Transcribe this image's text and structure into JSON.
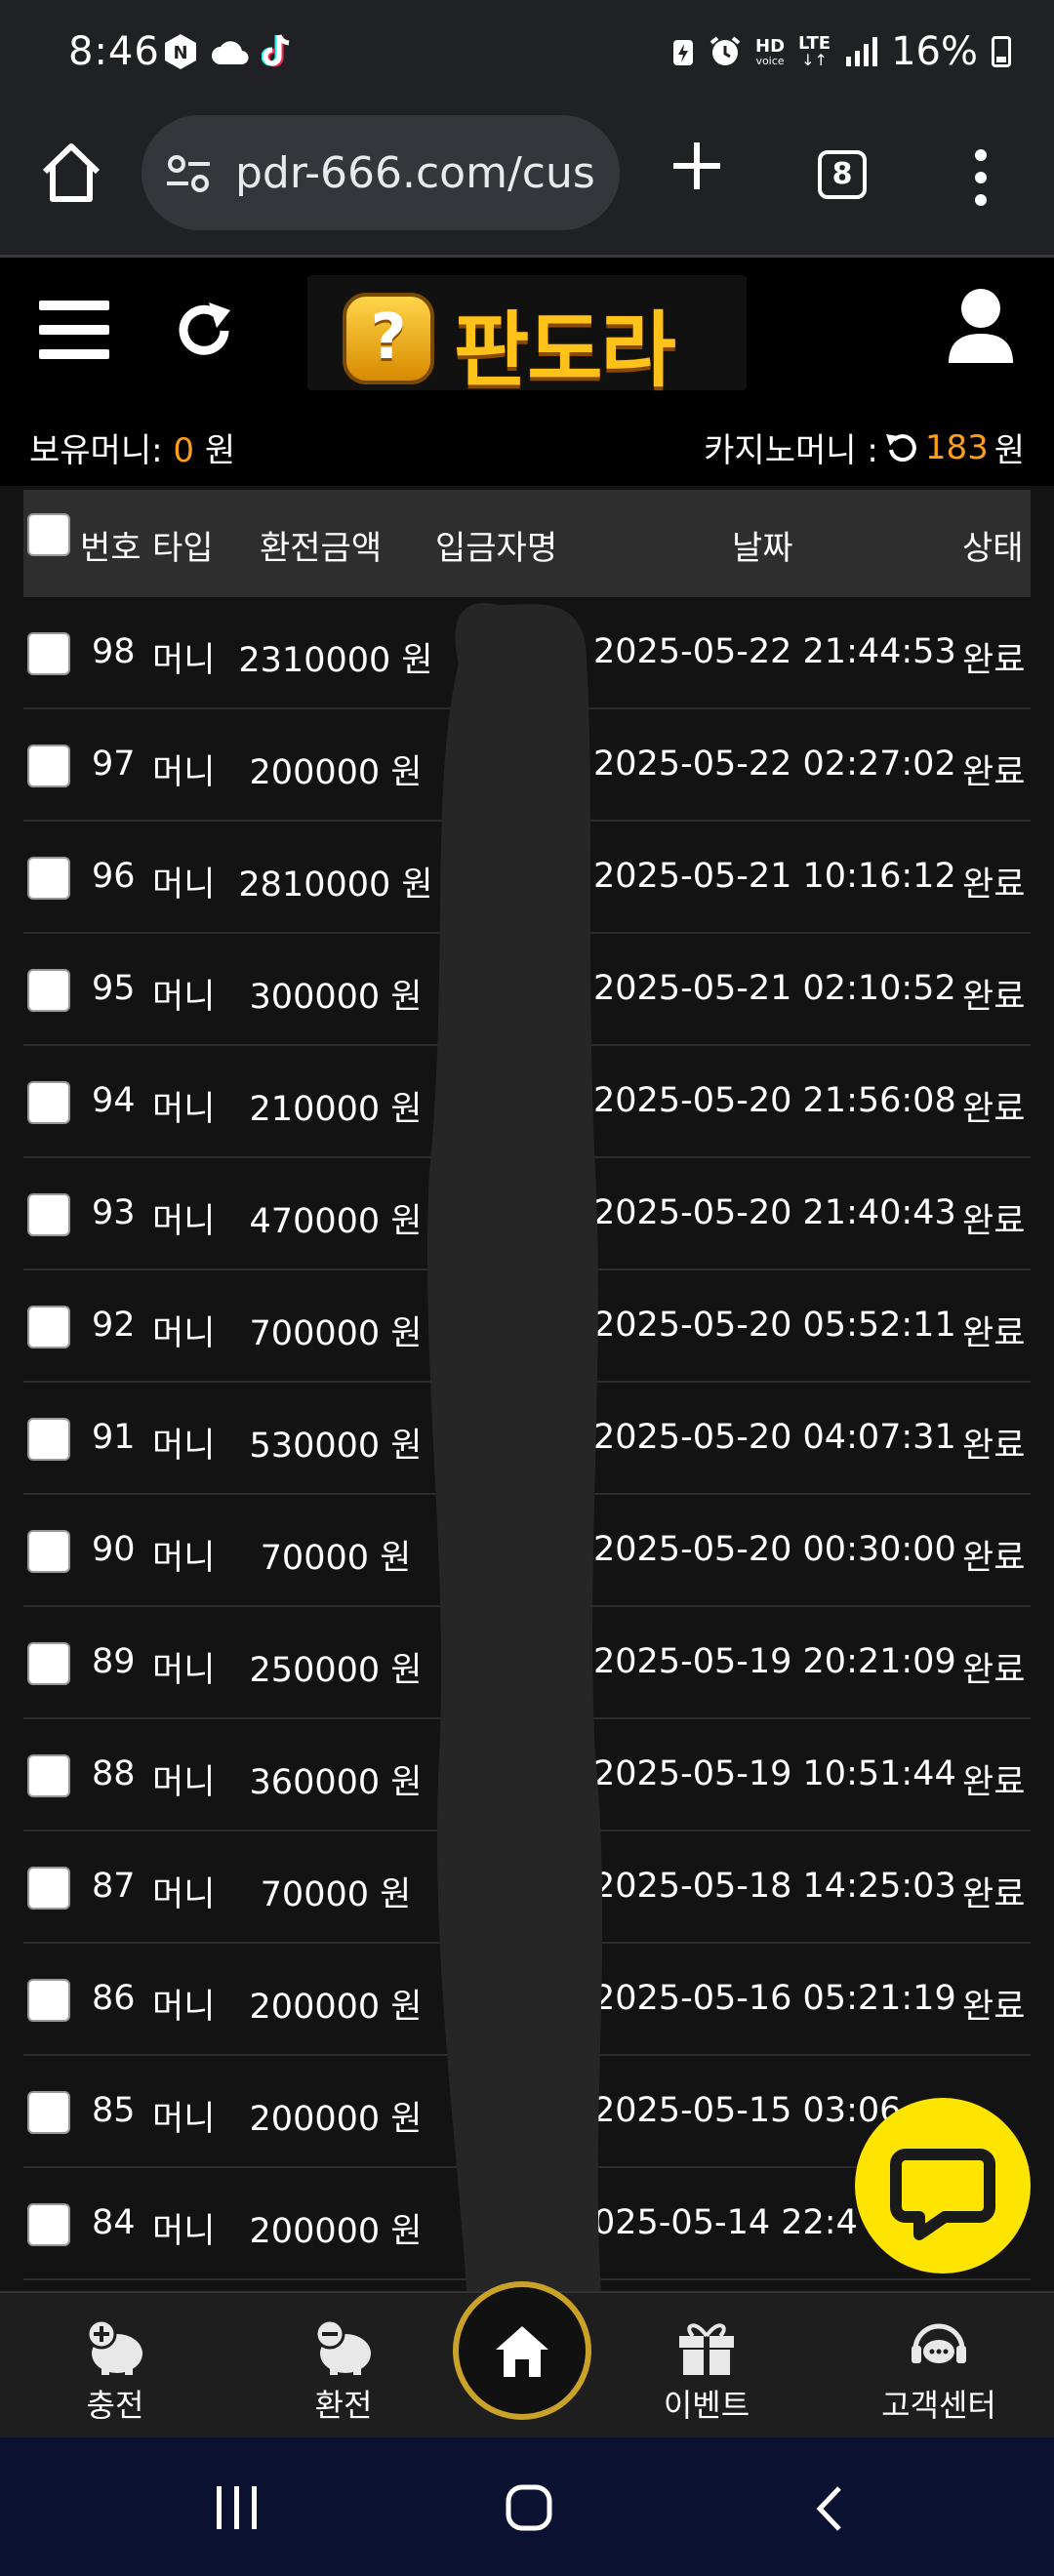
{
  "status_bar": {
    "time": "8:46",
    "battery": "16%",
    "hd_label": "HD",
    "voice_label": "voice",
    "lte_label": "LTE"
  },
  "browser": {
    "url": "pdr-666.com/cus",
    "tab_count": "8"
  },
  "site": {
    "logo_text": "판도라",
    "logo_badge": "?"
  },
  "money": {
    "held_label": "보유머니:",
    "held_value": "0",
    "held_unit": "원",
    "casino_label": "카지노머니 :",
    "casino_value": "183",
    "casino_unit": "원"
  },
  "table": {
    "headers": {
      "number": "번호",
      "type": "타입",
      "amount": "환전금액",
      "depositor": "입금자명",
      "date": "날짜",
      "status": "상태"
    },
    "rows": [
      {
        "num": "98",
        "type": "머니",
        "amount": "2310000 원",
        "date": "2025-05-22 21:44:53",
        "status": "완료"
      },
      {
        "num": "97",
        "type": "머니",
        "amount": "200000 원",
        "date": "2025-05-22 02:27:02",
        "status": "완료"
      },
      {
        "num": "96",
        "type": "머니",
        "amount": "2810000 원",
        "date": "2025-05-21 10:16:12",
        "status": "완료"
      },
      {
        "num": "95",
        "type": "머니",
        "amount": "300000 원",
        "date": "2025-05-21 02:10:52",
        "status": "완료"
      },
      {
        "num": "94",
        "type": "머니",
        "amount": "210000 원",
        "date": "2025-05-20 21:56:08",
        "status": "완료"
      },
      {
        "num": "93",
        "type": "머니",
        "amount": "470000 원",
        "date": "2025-05-20 21:40:43",
        "status": "완료"
      },
      {
        "num": "92",
        "type": "머니",
        "amount": "700000 원",
        "date": "2025-05-20 05:52:11",
        "status": "완료"
      },
      {
        "num": "91",
        "type": "머니",
        "amount": "530000 원",
        "date": "2025-05-20 04:07:31",
        "status": "완료"
      },
      {
        "num": "90",
        "type": "머니",
        "amount": "70000 원",
        "date": "2025-05-20 00:30:00",
        "status": "완료"
      },
      {
        "num": "89",
        "type": "머니",
        "amount": "250000 원",
        "date": "2025-05-19 20:21:09",
        "status": "완료"
      },
      {
        "num": "88",
        "type": "머니",
        "amount": "360000 원",
        "date": "2025-05-19 10:51:44",
        "status": "완료"
      },
      {
        "num": "87",
        "type": "머니",
        "amount": "70000 원",
        "date": "2025-05-18 14:25:03",
        "status": "완료"
      },
      {
        "num": "86",
        "type": "머니",
        "amount": "200000 원",
        "date": "2025-05-16 05:21:19",
        "status": "완료"
      },
      {
        "num": "85",
        "type": "머니",
        "amount": "200000 원",
        "date": "2025-05-15 03:06",
        "status": ""
      },
      {
        "num": "84",
        "type": "머니",
        "amount": "200000 원",
        "date": "025-05-14 22:4",
        "status": ""
      }
    ]
  },
  "bottom_nav": {
    "charge": "충전",
    "exchange": "환전",
    "event": "이벤트",
    "support": "고객센터"
  },
  "colors": {
    "accent_orange": "#ff9e1b",
    "chat_yellow": "#fee500",
    "home_ring_gold": "#c9a227"
  }
}
